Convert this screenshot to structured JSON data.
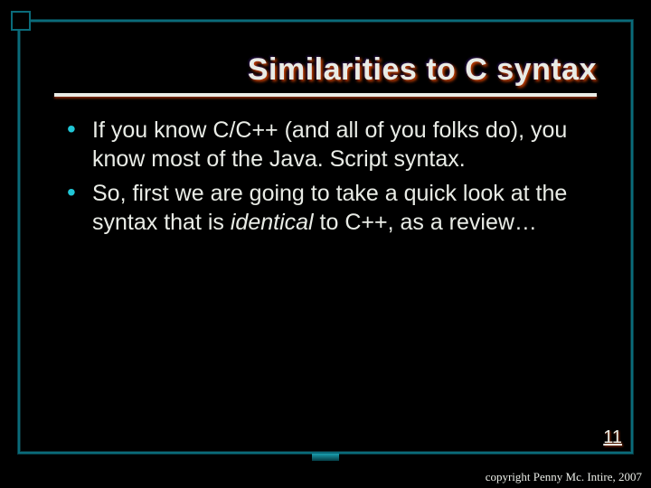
{
  "title": "Similarities to C syntax",
  "bullets": [
    {
      "pre": "If you know C/C++ (and all of you folks do), you know most of the Java. Script syntax.",
      "em": "",
      "post": ""
    },
    {
      "pre": "So, first we are going to take a quick look at the syntax that is ",
      "em": "identical",
      "post": " to C++, as a review…"
    }
  ],
  "page_number": "11",
  "copyright": "copyright Penny Mc. Intire, 2007"
}
